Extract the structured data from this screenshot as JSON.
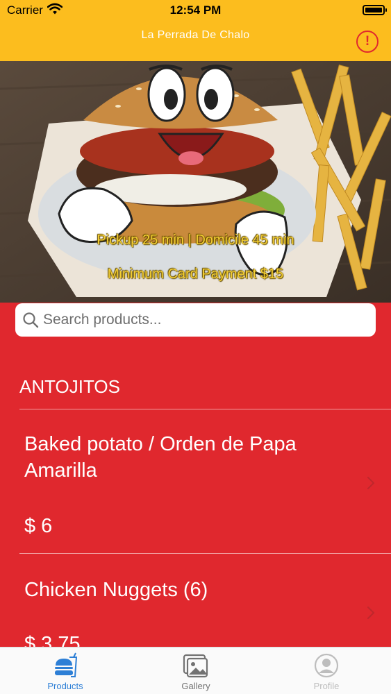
{
  "status_bar": {
    "carrier": "Carrier",
    "time": "12:54 PM"
  },
  "nav": {
    "title": "La Perrada De Chalo",
    "alert_symbol": "!"
  },
  "hero": {
    "line1": "Pickup 25 min | Domicile 45 min",
    "line2": "Minimum Card Payment $15"
  },
  "search": {
    "placeholder": "Search products...",
    "value": ""
  },
  "section": {
    "title": "ANTOJITOS"
  },
  "products": [
    {
      "name": "Baked potato / Orden de Papa Amarilla",
      "price": "$ 6"
    },
    {
      "name": "Chicken Nuggets (6)",
      "price": "$ 3.75"
    }
  ],
  "tabs": [
    {
      "label": "Products",
      "icon": "fast-food-icon"
    },
    {
      "label": "Gallery",
      "icon": "gallery-icon"
    },
    {
      "label": "Profile",
      "icon": "profile-icon"
    }
  ],
  "colors": {
    "header": "#fcbd1e",
    "background": "#e0282e",
    "accent": "#2d7fd6",
    "hero_text": "#f5cf34"
  }
}
